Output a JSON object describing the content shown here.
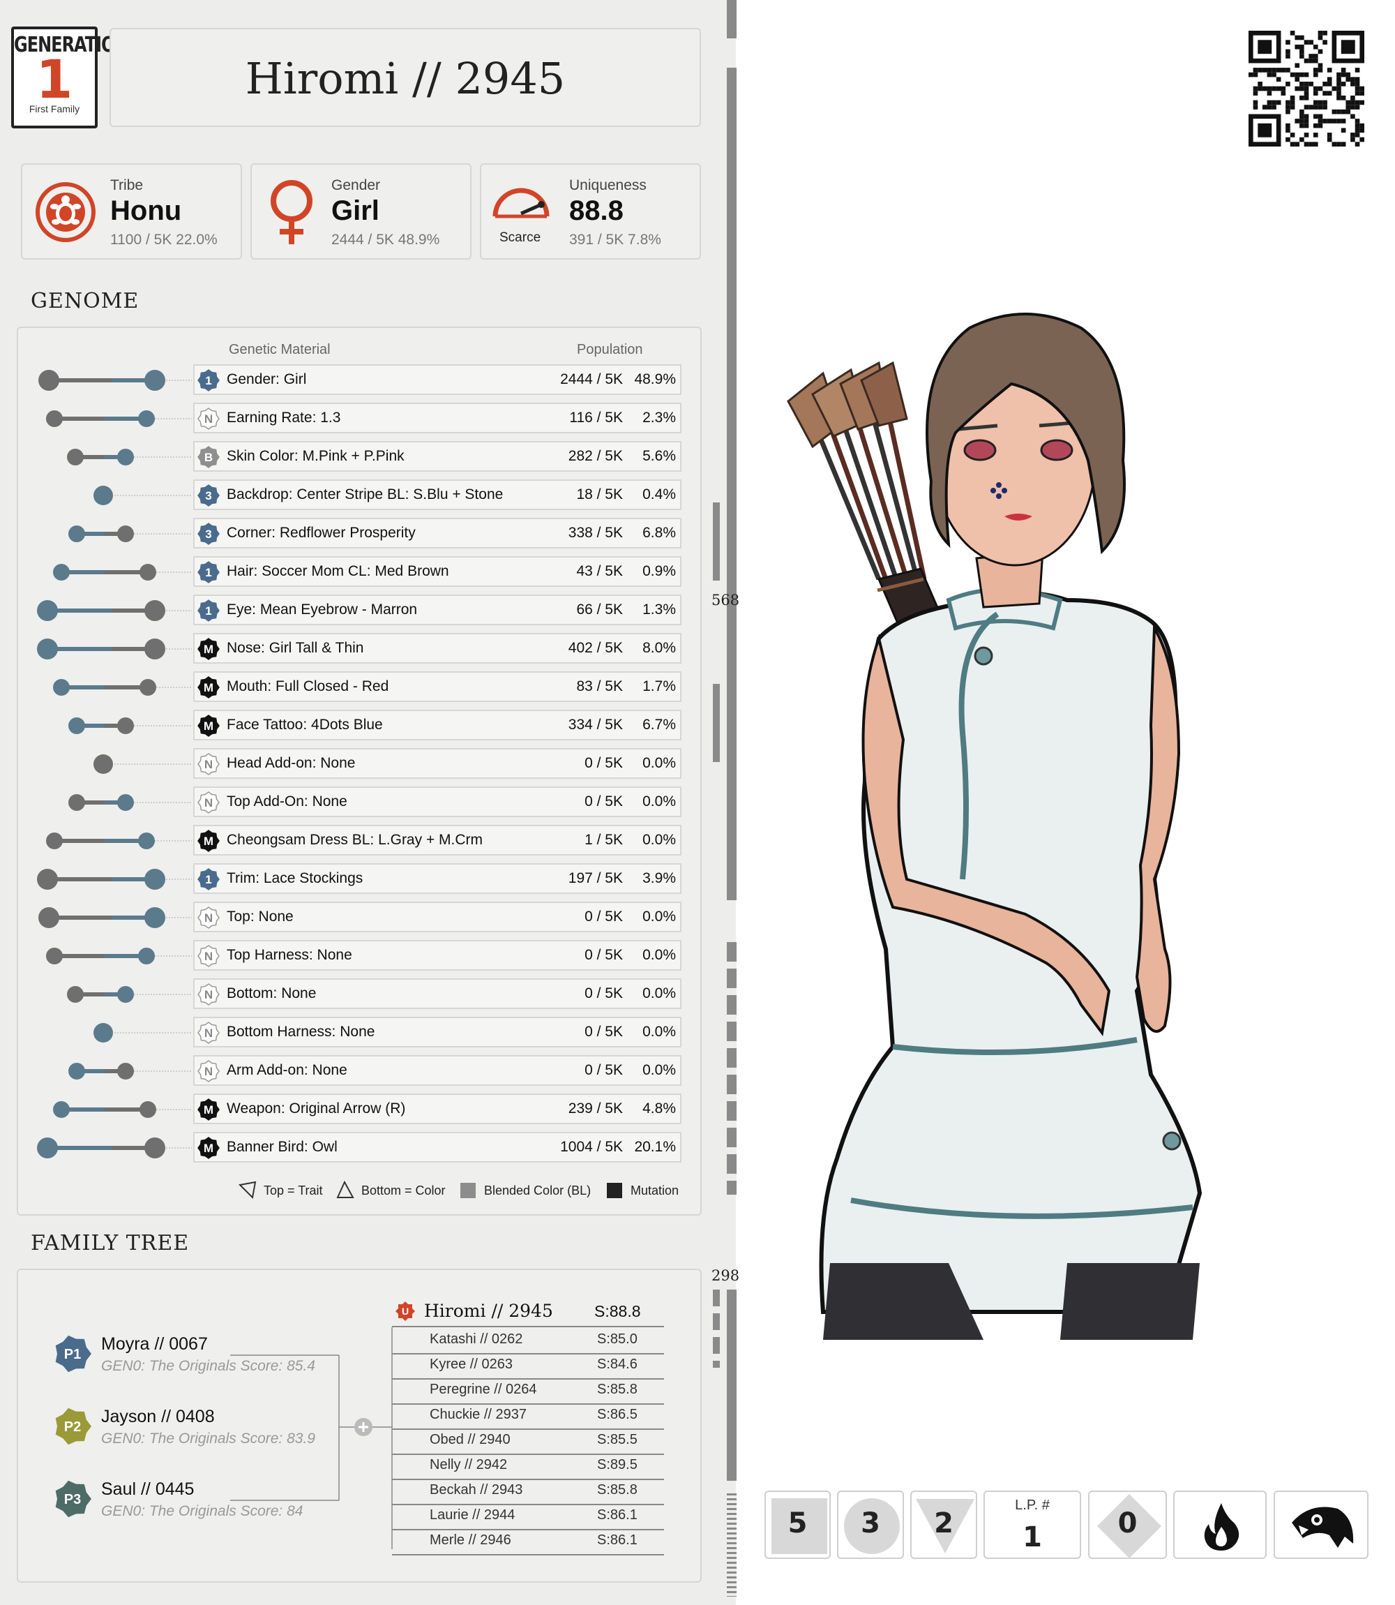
{
  "generation": {
    "top": "GENERATION",
    "number": "1",
    "subtitle": "First Family"
  },
  "title": "Hiromi  //  2945",
  "stats": [
    {
      "label": "Tribe",
      "value": "Honu",
      "sub": "1100 / 5K  22.0%"
    },
    {
      "label": "Gender",
      "value": "Girl",
      "sub": "2444 / 5K  48.9%"
    },
    {
      "label": "Uniqueness",
      "value": "88.8",
      "badge": "Scarce",
      "sub": "391 / 5K  7.8%"
    }
  ],
  "genome": {
    "title": "GENOME",
    "header_material": "Genetic Material",
    "header_population": "Population",
    "rows": [
      {
        "badge": "1",
        "label": "Gender: Girl",
        "count": "2444 / 5K",
        "pct": "48.9%"
      },
      {
        "badge": "N",
        "label": "Earning Rate: 1.3",
        "count": "116 / 5K",
        "pct": "2.3%"
      },
      {
        "badge": "B",
        "label": "Skin Color: M.Pink + P.Pink",
        "count": "282 / 5K",
        "pct": "5.6%"
      },
      {
        "badge": "3",
        "label": "Backdrop: Center Stripe BL: S.Blu + Stone",
        "count": "18 / 5K",
        "pct": "0.4%"
      },
      {
        "badge": "3",
        "label": "Corner: Redflower Prosperity",
        "count": "338 / 5K",
        "pct": "6.8%"
      },
      {
        "badge": "1",
        "label": "Hair: Soccer Mom  CL: Med Brown",
        "count": "43 / 5K",
        "pct": "0.9%"
      },
      {
        "badge": "1",
        "label": "Eye: Mean Eyebrow - Marron",
        "count": "66 / 5K",
        "pct": "1.3%"
      },
      {
        "badge": "M",
        "label": "Nose: Girl Tall & Thin",
        "count": "402 / 5K",
        "pct": "8.0%"
      },
      {
        "badge": "M",
        "label": "Mouth: Full Closed - Red",
        "count": "83 / 5K",
        "pct": "1.7%"
      },
      {
        "badge": "M",
        "label": "Face Tattoo: 4Dots Blue",
        "count": "334 / 5K",
        "pct": "6.7%"
      },
      {
        "badge": "N",
        "label": "Head Add-on:  None",
        "count": "0 / 5K",
        "pct": "0.0%"
      },
      {
        "badge": "N",
        "label": "Top Add-On: None",
        "count": "0 / 5K",
        "pct": "0.0%"
      },
      {
        "badge": "M",
        "label": "Cheongsam Dress BL: L.Gray + M.Crm",
        "count": "1 / 5K",
        "pct": "0.0%"
      },
      {
        "badge": "1",
        "label": "Trim: Lace Stockings",
        "count": "197 / 5K",
        "pct": "3.9%"
      },
      {
        "badge": "N",
        "label": "Top: None",
        "count": "0 / 5K",
        "pct": "0.0%"
      },
      {
        "badge": "N",
        "label": "Top Harness: None",
        "count": "0 / 5K",
        "pct": "0.0%"
      },
      {
        "badge": "N",
        "label": "Bottom: None",
        "count": "0 / 5K",
        "pct": "0.0%"
      },
      {
        "badge": "N",
        "label": "Bottom Harness: None",
        "count": "0 / 5K",
        "pct": "0.0%"
      },
      {
        "badge": "N",
        "label": "Arm Add-on: None",
        "count": "0 / 5K",
        "pct": "0.0%"
      },
      {
        "badge": "M",
        "label": "Weapon: Original Arrow (R)",
        "count": "239 / 5K",
        "pct": "4.8%"
      },
      {
        "badge": "M",
        "label": "Banner Bird:  Owl",
        "count": "1004 / 5K",
        "pct": "20.1%"
      }
    ],
    "legend": [
      "Top = Trait",
      "Bottom = Color",
      "Blended Color (BL)",
      "Mutation"
    ]
  },
  "family": {
    "title": "FAMILY TREE",
    "parents": [
      {
        "tag": "P1",
        "name": "Moyra  //  0067",
        "score": "GEN0: The Originals Score: 85.4",
        "color": "#4a6b8c"
      },
      {
        "tag": "P2",
        "name": "Jayson  //  0408",
        "score": "GEN0: The Originals Score: 83.9",
        "color": "#9a9a38"
      },
      {
        "tag": "P3",
        "name": "Saul  //  0445",
        "score": "GEN0: The Originals Score: 84",
        "color": "#4e6b66"
      }
    ],
    "self": {
      "tag": "U",
      "name": "Hiromi // 2945",
      "score": "S:88.8"
    },
    "siblings": [
      {
        "name": "Katashi  //  0262",
        "score": "S:85.0"
      },
      {
        "name": "Kyree  //  0263",
        "score": "S:84.6"
      },
      {
        "name": "Peregrine  //  0264",
        "score": "S:85.8"
      },
      {
        "name": "Chuckie  //  2937",
        "score": "S:86.5"
      },
      {
        "name": "Obed  //  2940",
        "score": "S:85.5"
      },
      {
        "name": "Nelly  //  2942",
        "score": "S:89.5"
      },
      {
        "name": "Beckah  //  2943",
        "score": "S:85.8"
      },
      {
        "name": "Laurie  //  2944",
        "score": "S:86.1"
      },
      {
        "name": "Merle  //  2946",
        "score": "S:86.1"
      }
    ]
  },
  "ruler": {
    "mark1": "568",
    "mark2": "298"
  },
  "bottom_cards": [
    {
      "value": "5",
      "shape": "square"
    },
    {
      "value": "3",
      "shape": "circle"
    },
    {
      "value": "2",
      "shape": "triangle"
    },
    {
      "label": "L.P. #",
      "value": "1",
      "shape": "plain"
    },
    {
      "value": "0",
      "shape": "diamond"
    },
    {
      "icon": "flame-icon"
    },
    {
      "icon": "owl-icon"
    }
  ],
  "colors": {
    "accent": "#d14527",
    "steel": "#5b7a8c",
    "gray": "#6f6f6f",
    "panel": "#ededec"
  }
}
